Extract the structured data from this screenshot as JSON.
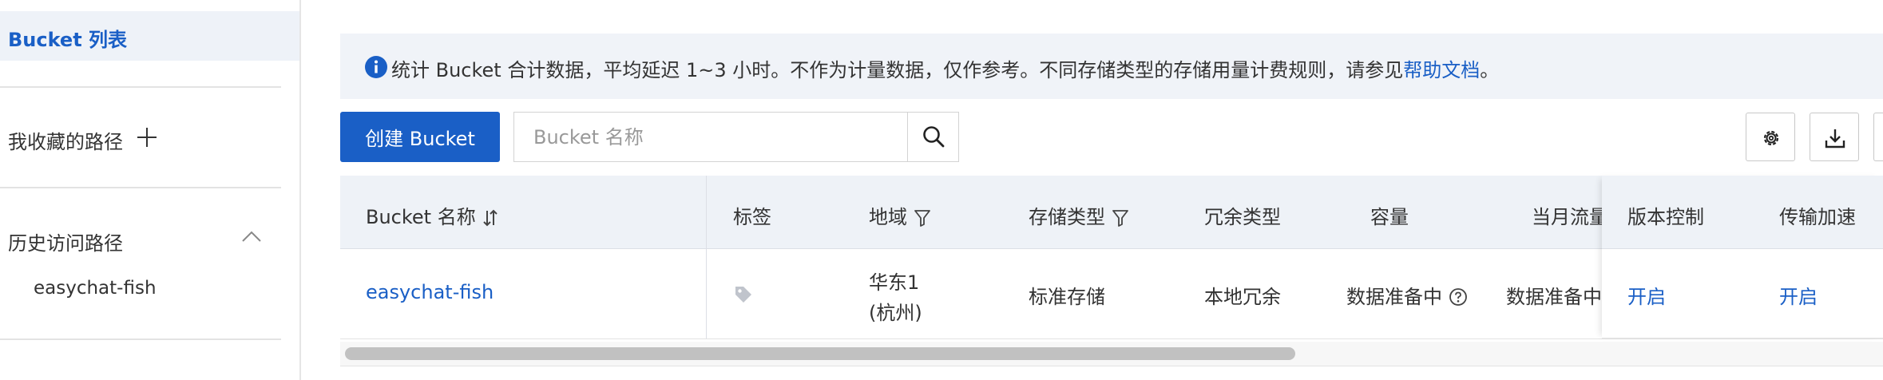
{
  "sidebar": {
    "active_item": "Bucket 列表",
    "favorites_label": "我收藏的路径",
    "history_label": "历史访问路径",
    "history_items": [
      "easychat-fish"
    ]
  },
  "notice": {
    "text": "统计 Bucket 合计数据，平均延迟 1~3 小时。不作为计量数据，仅作参考。不同存储类型的存储用量计费规则，请参见",
    "link": "帮助文档",
    "suffix": "。"
  },
  "toolbar": {
    "create_button": "创建 Bucket",
    "search_placeholder": "Bucket 名称"
  },
  "table": {
    "columns": [
      "Bucket 名称",
      "标签",
      "地域",
      "存储类型",
      "冗余类型",
      "容量",
      "当月流量",
      "版本控制",
      "传输加速"
    ],
    "rows": [
      {
        "name": "easychat-fish",
        "region_line1": "华东1",
        "region_line2": "(杭州)",
        "storage_type": "标准存储",
        "redundancy": "本地冗余",
        "capacity": "数据准备中",
        "monthly_traffic": "数据准备中",
        "versioning": "开启",
        "acceleration": "开启"
      }
    ]
  },
  "colors": {
    "accent": "#1a5fc6",
    "header_bg": "#eef2f7",
    "notice_bg": "#f0f3f8"
  }
}
